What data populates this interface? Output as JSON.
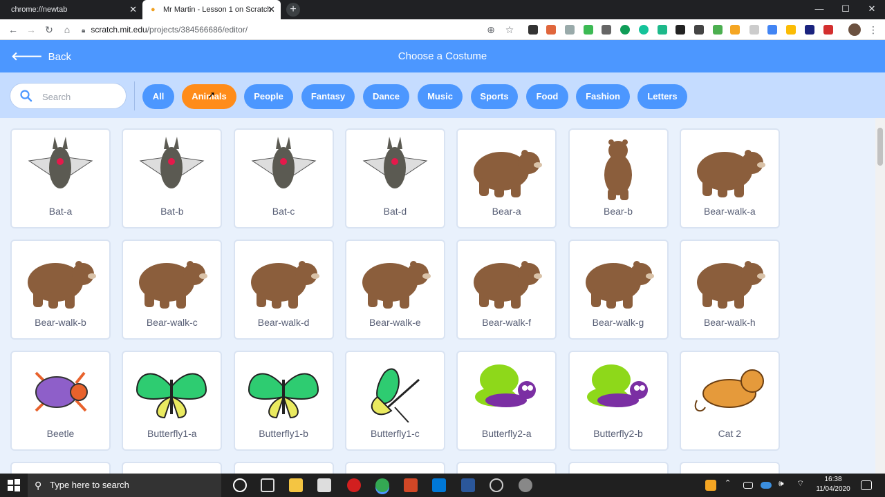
{
  "browser": {
    "tabs": [
      {
        "title": "chrome://newtab"
      },
      {
        "title": "Mr Martin - Lesson 1 on Scratch"
      }
    ],
    "url_host": "scratch.mit.edu",
    "url_path": "/projects/384566686/editor/"
  },
  "header": {
    "back_label": "Back",
    "title": "Choose a Costume"
  },
  "search": {
    "placeholder": "Search"
  },
  "filters": [
    {
      "label": "All"
    },
    {
      "label": "Animals",
      "active": true
    },
    {
      "label": "People"
    },
    {
      "label": "Fantasy"
    },
    {
      "label": "Dance"
    },
    {
      "label": "Music"
    },
    {
      "label": "Sports"
    },
    {
      "label": "Food"
    },
    {
      "label": "Fashion"
    },
    {
      "label": "Letters"
    }
  ],
  "costumes": [
    {
      "name": "Bat-a",
      "icon": "bat-icon"
    },
    {
      "name": "Bat-b",
      "icon": "bat-icon"
    },
    {
      "name": "Bat-c",
      "icon": "bat-icon"
    },
    {
      "name": "Bat-d",
      "icon": "bat-icon"
    },
    {
      "name": "Bear-a",
      "icon": "bear-icon"
    },
    {
      "name": "Bear-b",
      "icon": "bear-standing-icon"
    },
    {
      "name": "Bear-walk-a",
      "icon": "bear-icon"
    },
    {
      "name": "Bear-walk-b",
      "icon": "bear-icon"
    },
    {
      "name": "Bear-walk-c",
      "icon": "bear-icon"
    },
    {
      "name": "Bear-walk-d",
      "icon": "bear-icon"
    },
    {
      "name": "Bear-walk-e",
      "icon": "bear-icon"
    },
    {
      "name": "Bear-walk-f",
      "icon": "bear-icon"
    },
    {
      "name": "Bear-walk-g",
      "icon": "bear-icon"
    },
    {
      "name": "Bear-walk-h",
      "icon": "bear-icon"
    },
    {
      "name": "Beetle",
      "icon": "beetle-icon"
    },
    {
      "name": "Butterfly1-a",
      "icon": "butterfly-icon"
    },
    {
      "name": "Butterfly1-b",
      "icon": "butterfly-icon"
    },
    {
      "name": "Butterfly1-c",
      "icon": "butterfly-side-icon"
    },
    {
      "name": "Butterfly2-a",
      "icon": "butterfly2-icon"
    },
    {
      "name": "Butterfly2-b",
      "icon": "butterfly2-icon"
    },
    {
      "name": "Cat 2",
      "icon": "cat-icon"
    }
  ],
  "taskbar": {
    "search_placeholder": "Type here to search",
    "time": "16:38",
    "date": "11/04/2020"
  },
  "colors": {
    "header": "#4c97ff",
    "filter_bar": "#c5dcff",
    "active_filter": "#ff8c1a",
    "grid_bg": "#e9f1fc"
  }
}
